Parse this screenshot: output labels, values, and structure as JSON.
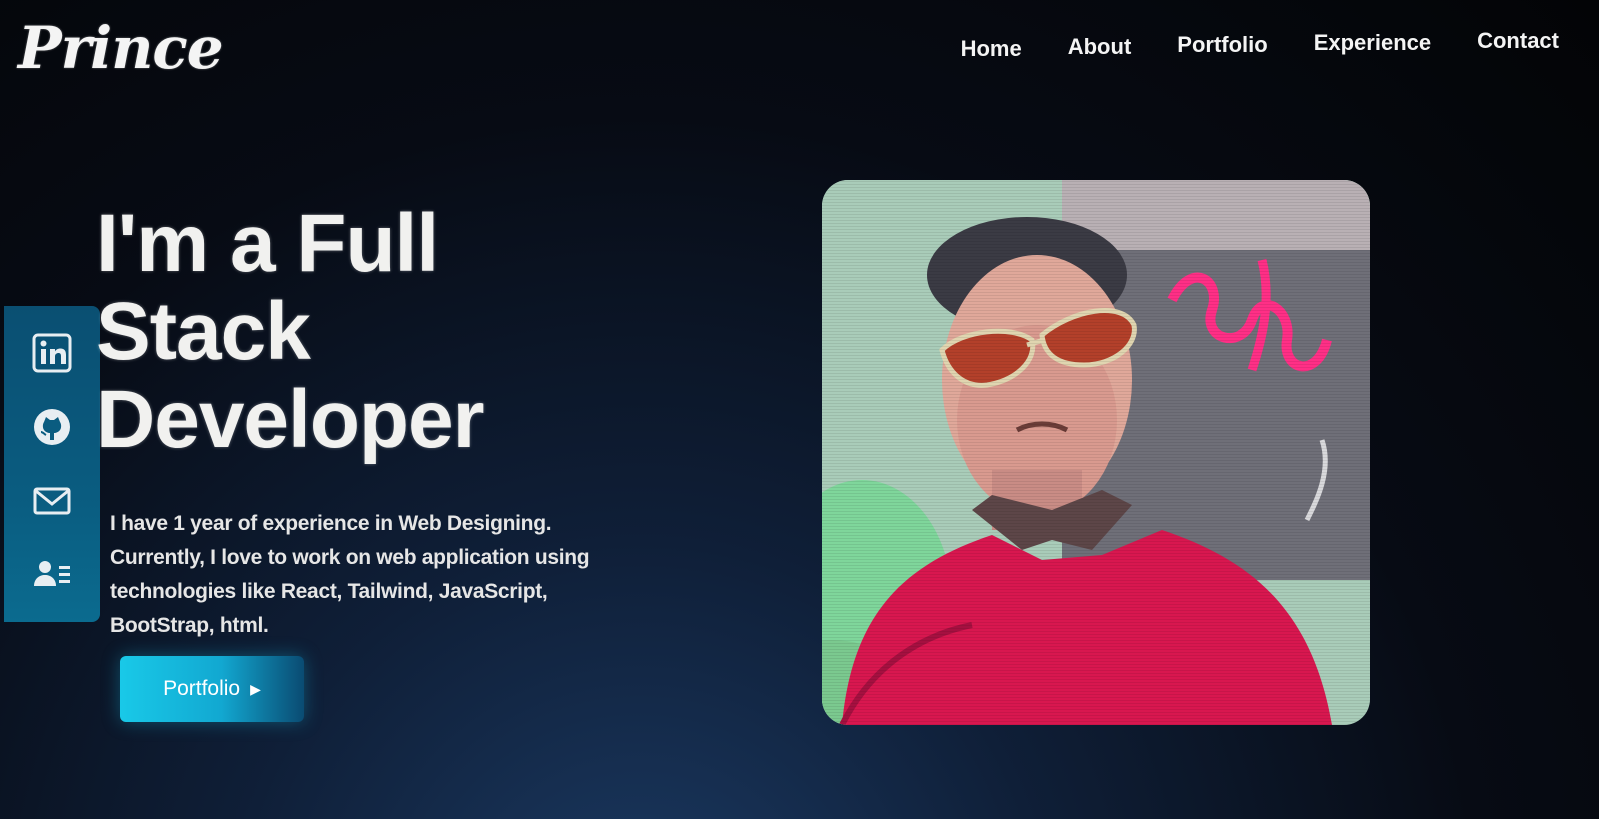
{
  "brand": {
    "logo_text": "Prince"
  },
  "nav": {
    "items": [
      {
        "label": "Home"
      },
      {
        "label": "About"
      },
      {
        "label": "Portfolio"
      },
      {
        "label": "Experience"
      },
      {
        "label": "Contact"
      }
    ]
  },
  "social": {
    "icons": [
      "linkedin-icon",
      "github-icon",
      "mail-icon",
      "contact-card-icon"
    ]
  },
  "hero": {
    "title_line1": "I'm a Full",
    "title_line2": "Stack",
    "title_line3": "Developer",
    "description": "I have 1 year of experience in Web Designing. Currently, I love to work on web application using technologies like React, Tailwind, JavaScript, BootStrap, html.",
    "cta_label": "Portfolio"
  },
  "colors": {
    "accent": "#19c9e8",
    "sidebar": "#0a5c80",
    "background": "#05070c"
  }
}
